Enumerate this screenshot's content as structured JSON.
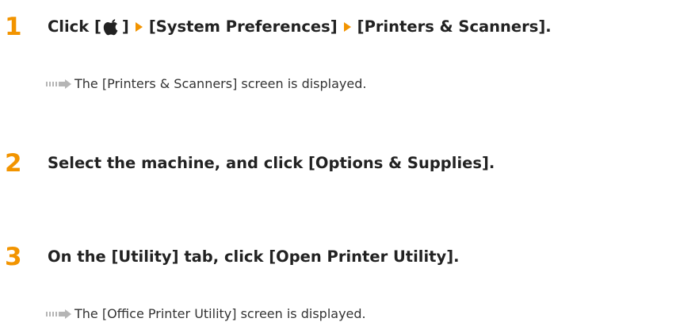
{
  "colors": {
    "accent_orange": "#f29400",
    "text": "#222222",
    "result_arrow_gray": "#b5b5b5"
  },
  "steps": [
    {
      "number": "1",
      "title_parts": {
        "click": "Click [",
        "close_bracket": "]",
        "system_preferences": "[System Preferences]",
        "printers_scanners": "[Printers & Scanners]."
      },
      "result": "The [Printers & Scanners] screen is displayed."
    },
    {
      "number": "2",
      "title": "Select the machine, and click [Options & Supplies]."
    },
    {
      "number": "3",
      "title": "On the [Utility] tab, click [Open Printer Utility].",
      "result": "The [Office Printer Utility] screen is displayed."
    }
  ],
  "icons": {
    "apple_menu": "apple-icon",
    "nav_separator": "triangle-right-icon",
    "result_indicator": "result-arrow-icon"
  }
}
